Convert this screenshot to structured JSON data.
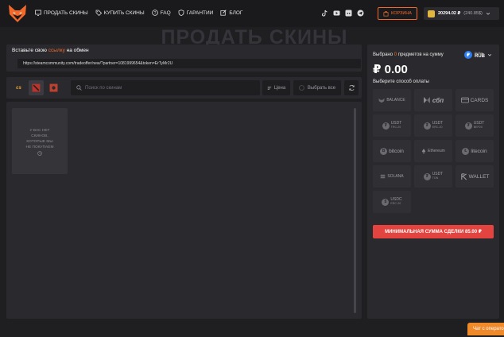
{
  "header": {
    "nav": [
      {
        "label": "ПРОДАТЬ СКИНЫ",
        "icon": "monitor-icon"
      },
      {
        "label": "КУПИТЬ СКИНЫ",
        "icon": "tag-icon"
      },
      {
        "label": "FAQ",
        "icon": "question-icon"
      },
      {
        "label": "ГАРАНТИИ",
        "icon": "shield-icon"
      },
      {
        "label": "БЛОГ",
        "icon": "edit-icon"
      }
    ],
    "socials": [
      "tiktok-icon",
      "youtube-icon",
      "discord-icon",
      "telegram-icon"
    ],
    "cart_label": "КОРЗИНА",
    "balance": "20294.02 ₽",
    "balance_sub": "(240.85$)"
  },
  "page_title": "ПРОДАТЬ СКИНЫ",
  "trade_link": {
    "title_pre": "Вставьте свою",
    "title_link": "ссылку",
    "title_post": "на обмен",
    "value": "https://steamcommunity.com/tradeoffer/new/?partner=1081999654&token=ErTyMr2U"
  },
  "filters": {
    "games": [
      "cs-icon",
      "dota-icon",
      "rust-icon"
    ],
    "game_cs_label": "cs",
    "search_placeholder": "Поиск по скинам",
    "price_label": "Цена",
    "select_all_label": "Выбрать все"
  },
  "inventory": {
    "empty_lines": [
      "У ВАС НЕТ",
      "СКИНОВ,",
      "КОТОРЫЕ МЫ",
      "НЕ ПОКУПАЕМ"
    ]
  },
  "summary": {
    "selected_pre": "Выбрано",
    "selected_count": "0",
    "selected_post": "предметов на сумму",
    "total": "₽ 0.00",
    "currency_small": "Рубль",
    "currency": "RUB",
    "currency_symbol": "₽",
    "payment_title": "Выберите способ оплаты",
    "payments": [
      {
        "label": "BALANCE",
        "tag": ""
      },
      {
        "label": "сбп",
        "tag": ""
      },
      {
        "label": "CARDS",
        "tag": ""
      },
      {
        "label": "USDT",
        "tag": "TRC-20"
      },
      {
        "label": "USDT",
        "tag": "ERC-20"
      },
      {
        "label": "USDT",
        "tag": "BEP20"
      },
      {
        "label": "bitcoin",
        "tag": ""
      },
      {
        "label": "Ethereum",
        "tag": ""
      },
      {
        "label": "litecoin",
        "tag": ""
      },
      {
        "label": "SOLANA",
        "tag": ""
      },
      {
        "label": "USDT",
        "tag": "TON"
      },
      {
        "label": "WALLET",
        "tag": ""
      },
      {
        "label": "USDC",
        "tag": "ERC-20"
      }
    ],
    "min_button": "МИНИМАЛЬНАЯ СУММА СДЕЛКИ 85.00 ₽"
  },
  "chat_label": "Чат с оператором",
  "colors": {
    "accent": "#f2692a",
    "danger": "#e4443f",
    "bg": "#1f1f22",
    "panel": "#2a2a2e"
  }
}
